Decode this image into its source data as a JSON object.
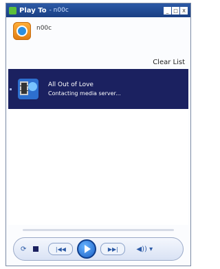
{
  "window": {
    "title": "Play To",
    "device": "- n00c",
    "controls": [
      "_",
      "□",
      "X"
    ]
  },
  "device": {
    "name": "n00c"
  },
  "actions": {
    "clear_list": "Clear List"
  },
  "playlist": {
    "items": [
      {
        "title": "All Out of Love",
        "status": "Contacting media server..."
      }
    ]
  },
  "transport": {
    "prev": "|◀◀",
    "next": "▶▶|",
    "volume": "◀)) ▾",
    "shuffle": "⟳"
  }
}
